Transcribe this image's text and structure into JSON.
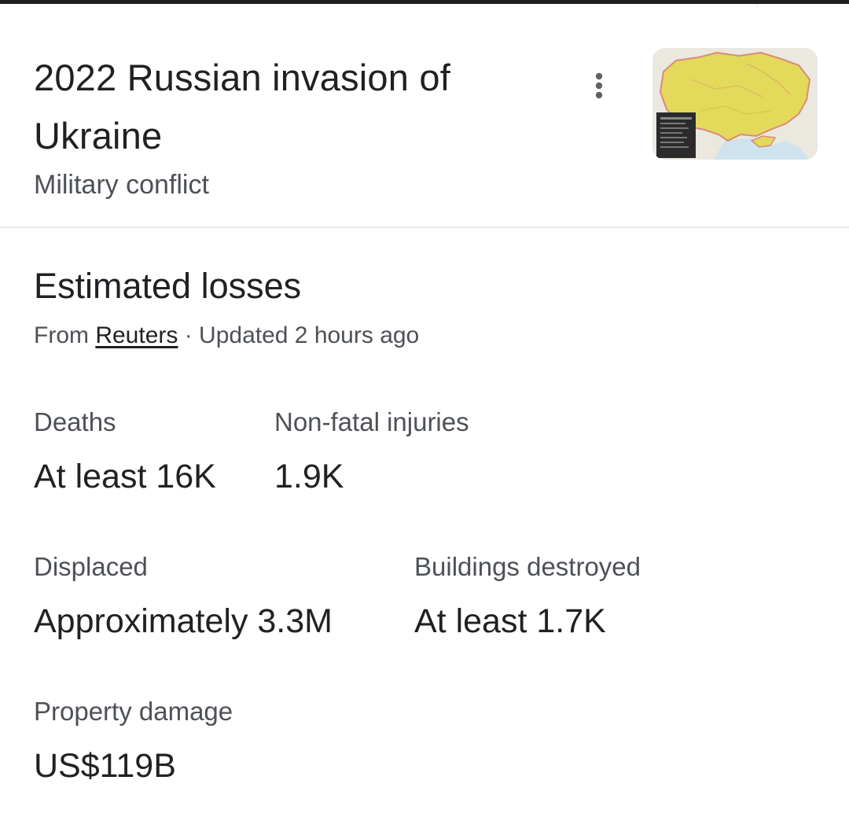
{
  "entity": {
    "title": "2022 Russian invasion of Ukraine",
    "subtitle": "Military conflict",
    "more_icon": "more-vert-icon",
    "thumbnail": "ukraine-map-thumbnail"
  },
  "losses": {
    "heading": "Estimated losses",
    "source_prefix": "From ",
    "source_name": "Reuters",
    "source_suffix": " · Updated 2 hours ago",
    "stats": [
      {
        "label": "Deaths",
        "value": "At least 16K"
      },
      {
        "label": "Non-fatal injuries",
        "value": "1.9K"
      },
      {
        "label": "Displaced",
        "value": "Approximately 3.3M"
      },
      {
        "label": "Buildings destroyed",
        "value": "At least 1.7K"
      },
      {
        "label": "Property damage",
        "value": "US$119B"
      }
    ]
  },
  "colors": {
    "title_text": "#202124",
    "secondary_text": "#4d5156",
    "map_land": "#e3d95a",
    "map_sea": "#cfe3ef"
  }
}
